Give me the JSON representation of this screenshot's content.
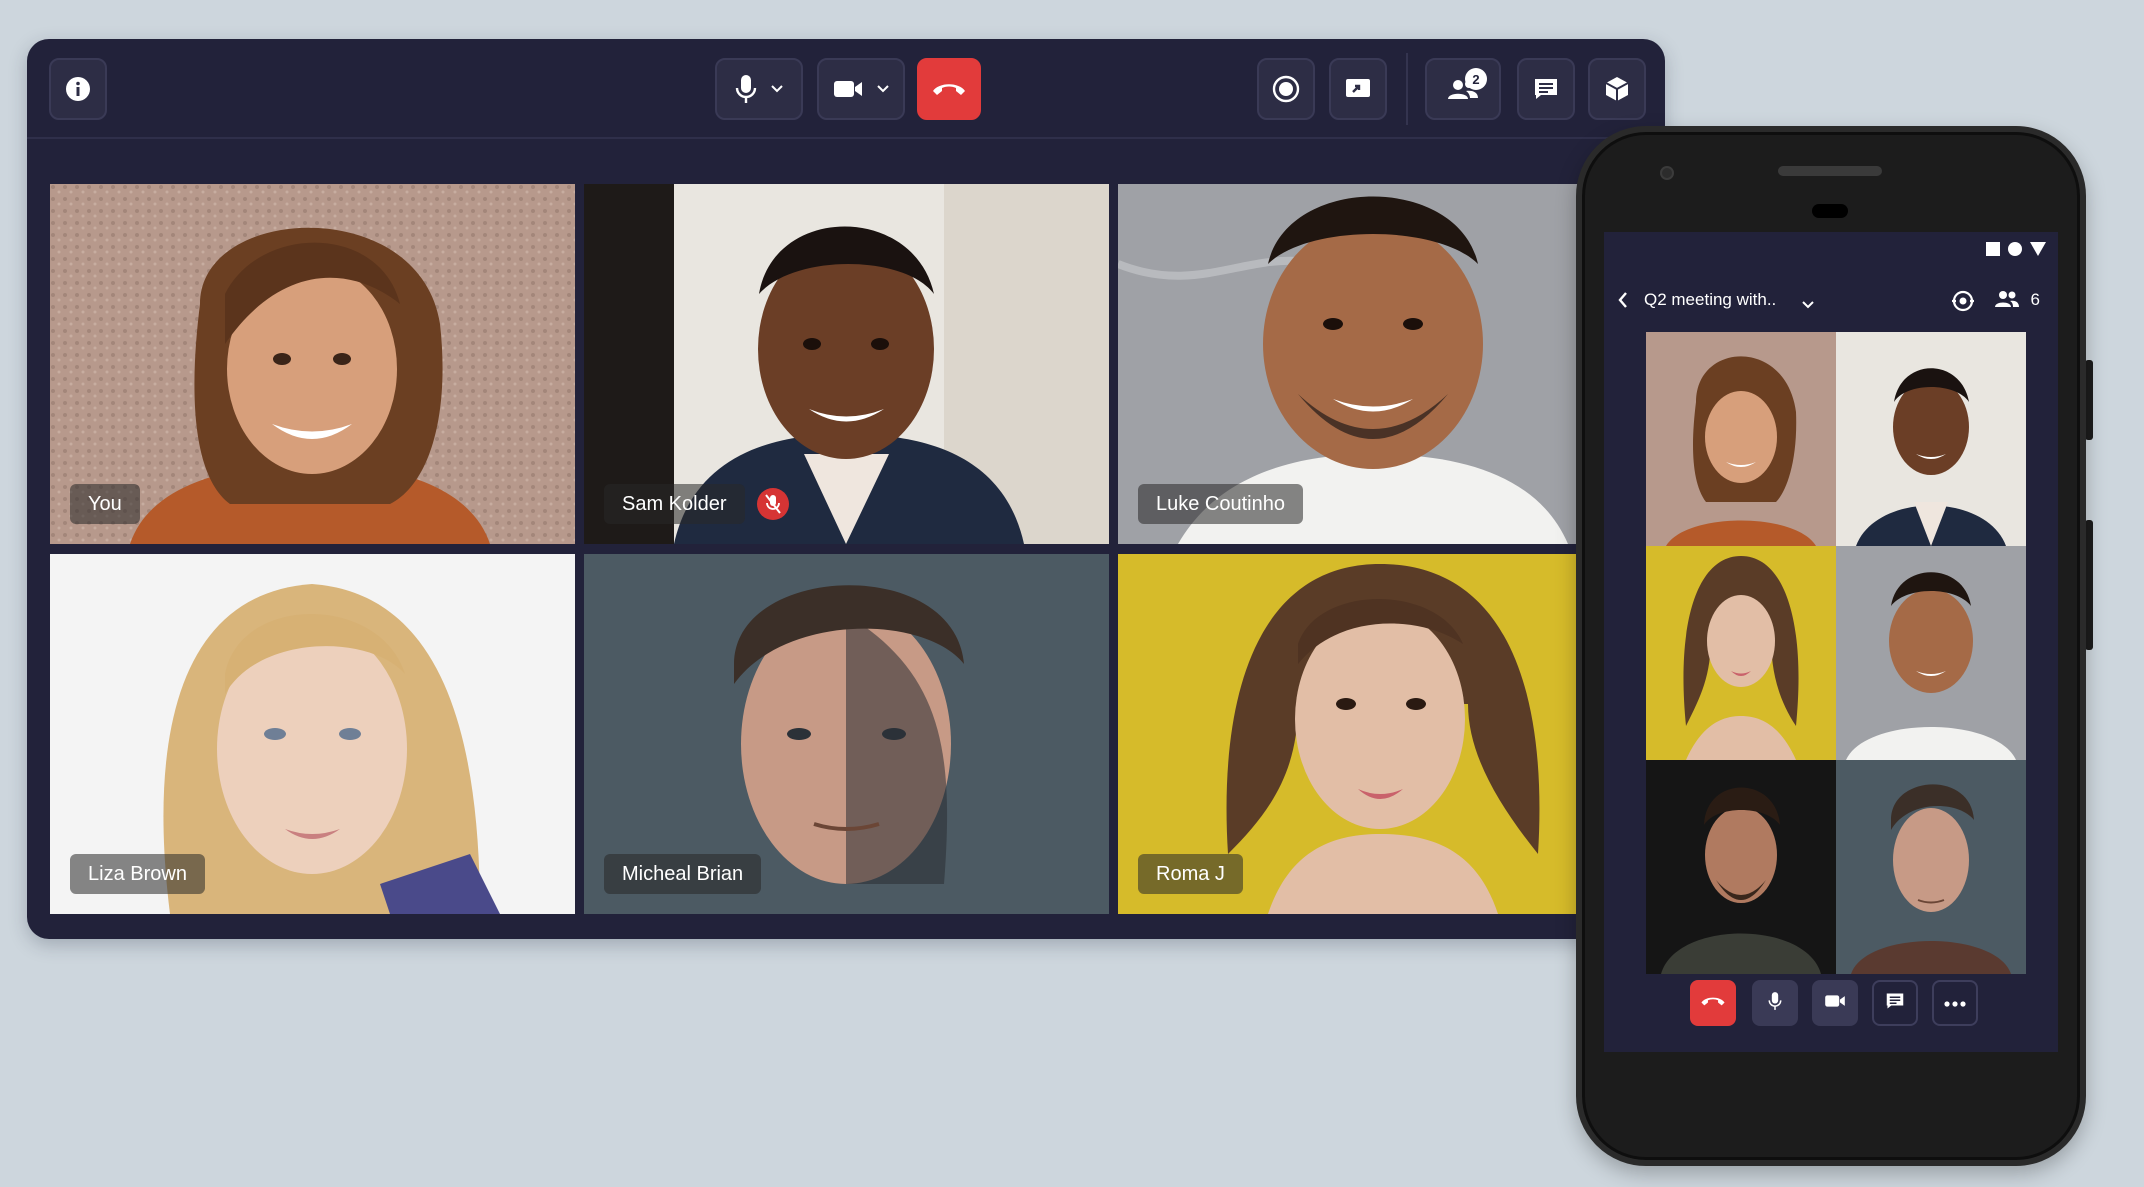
{
  "toolbar": {
    "info_icon": "info-icon",
    "mic_icon": "microphone-icon",
    "camera_icon": "video-camera-icon",
    "end_call_icon": "phone-hangup-icon",
    "record_icon": "record-icon",
    "share_icon": "screen-share-icon",
    "participants_icon": "participants-icon",
    "participants_badge": "2",
    "chat_icon": "chat-icon",
    "apps_icon": "cube-icon"
  },
  "participants": [
    {
      "name": "You"
    },
    {
      "name": "Sam Kolder"
    },
    {
      "name": "Luke Coutinho"
    },
    {
      "name": "Liza Brown"
    },
    {
      "name": "Micheal Brian"
    },
    {
      "name": "Roma J"
    }
  ],
  "mobile": {
    "meeting_title": "Q2 meeting with..",
    "participant_count": "6",
    "back_icon": "chevron-left-icon",
    "dropdown_icon": "chevron-down-icon",
    "camera_switch_icon": "switch-camera-icon",
    "people_icon": "participants-icon",
    "controls": [
      "phone-hangup-icon",
      "microphone-icon",
      "video-camera-icon",
      "chat-icon",
      "more-icon"
    ]
  },
  "colors": {
    "window_bg": "#22223a",
    "end_call": "#e23b3b",
    "page_bg": "#cdd6dd"
  }
}
